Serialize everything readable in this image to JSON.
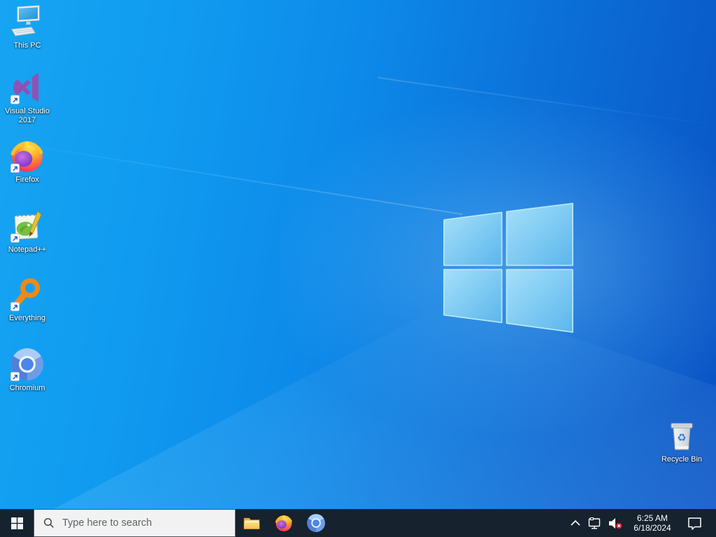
{
  "desktop": {
    "icons": [
      {
        "id": "this-pc",
        "label": "This PC",
        "shortcut_arrow": false
      },
      {
        "id": "visual-studio",
        "label": "Visual Studio 2017",
        "shortcut_arrow": true
      },
      {
        "id": "firefox",
        "label": "Firefox",
        "shortcut_arrow": true
      },
      {
        "id": "notepad-plus-plus",
        "label": "Notepad++",
        "shortcut_arrow": true
      },
      {
        "id": "everything",
        "label": "Everything",
        "shortcut_arrow": true
      },
      {
        "id": "chromium",
        "label": "Chromium",
        "shortcut_arrow": true
      },
      {
        "id": "recycle-bin",
        "label": "Recycle Bin",
        "shortcut_arrow": false
      }
    ],
    "wallpaper_logo": "windows-10-flag"
  },
  "taskbar": {
    "start_icon": "windows-logo-icon",
    "search": {
      "placeholder": "Type here to search",
      "icon": "search-icon"
    },
    "pinned_apps": [
      {
        "id": "file-explorer-icon"
      },
      {
        "id": "firefox-icon"
      },
      {
        "id": "chromium-icon"
      }
    ],
    "tray": {
      "icons": [
        "hidden-icons-chevron",
        "network-ethernet-icon",
        "volume-muted-icon",
        "action-center-icon"
      ],
      "time": "6:25 AM",
      "date": "6/18/2024"
    }
  },
  "colors": {
    "wallpaper_left": "#17a5f2",
    "wallpaper_right": "#0a51c3",
    "logo_pane_light": "#a5e0f9",
    "logo_pane_dark": "#5cb6ec",
    "taskbar_bg": "#16222d",
    "search_box_bg": "#f2f2f2",
    "search_text": "#5f6368",
    "icon_label_text": "#ffffff",
    "mute_badge_red": "#e8112d",
    "vs_purple": "#9250b4",
    "everything_orange": "#ee8a15",
    "folder_yellow": "#ffd96b"
  }
}
